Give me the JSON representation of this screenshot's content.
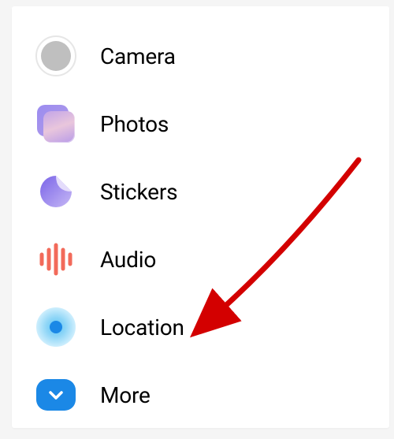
{
  "menu": {
    "items": [
      {
        "label": "Camera"
      },
      {
        "label": "Photos"
      },
      {
        "label": "Stickers"
      },
      {
        "label": "Audio"
      },
      {
        "label": "Location"
      },
      {
        "label": "More"
      }
    ]
  },
  "annotation": {
    "target": "location",
    "type": "arrow",
    "color": "#d30000"
  }
}
